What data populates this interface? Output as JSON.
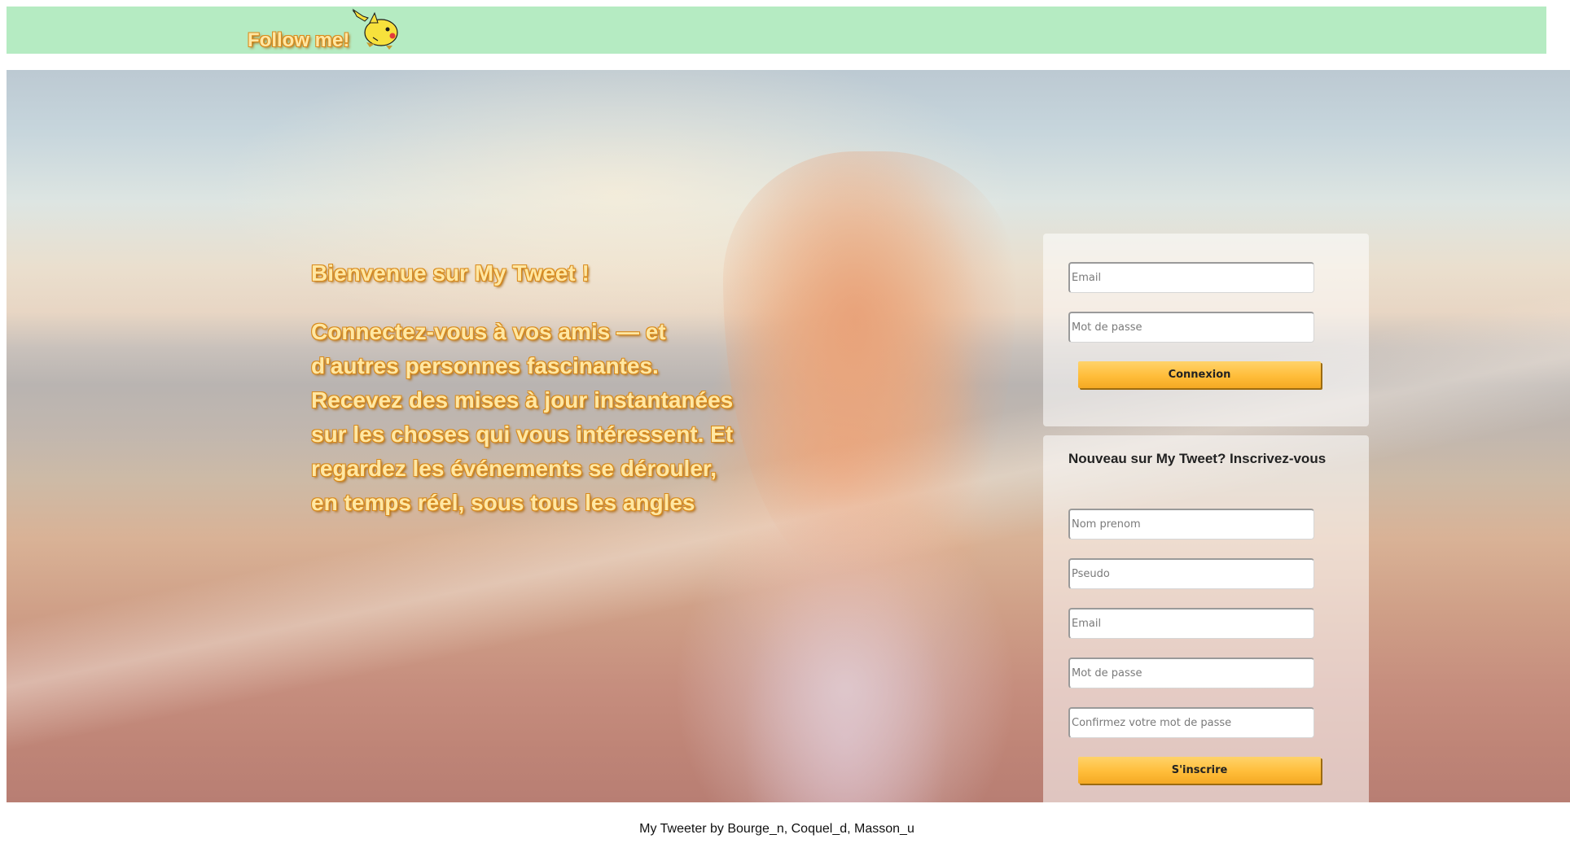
{
  "header": {
    "brand": "Follow me!",
    "mascot_icon": "pikachu-icon"
  },
  "hero": {
    "title": "Bienvenue sur My Tweet !",
    "text": "Connectez-vous à vos amis — et d'autres personnes fascinantes. Recevez des mises à jour instantanées sur les choses qui vous intéressent. Et regardez les événements se dérouler, en temps réel, sous tous les angles"
  },
  "login": {
    "email_placeholder": "Email",
    "password_placeholder": "Mot de passe",
    "submit_label": "Connexion"
  },
  "signup": {
    "title": "Nouveau sur My Tweet? Inscrivez-vous",
    "name_placeholder": "Nom prenom",
    "pseudo_placeholder": "Pseudo",
    "email_placeholder": "Email",
    "password_placeholder": "Mot de passe",
    "confirm_placeholder": "Confirmez votre mot de passe",
    "submit_label": "S'inscrire"
  },
  "footer": {
    "text": "My Tweeter by Bourge_n, Coquel_d, Masson_u"
  },
  "colors": {
    "topbar": "#b5ebc2",
    "accent_text": "#ffe7a3",
    "accent_outline": "#d98a1a",
    "button": "#ffbd3a"
  }
}
